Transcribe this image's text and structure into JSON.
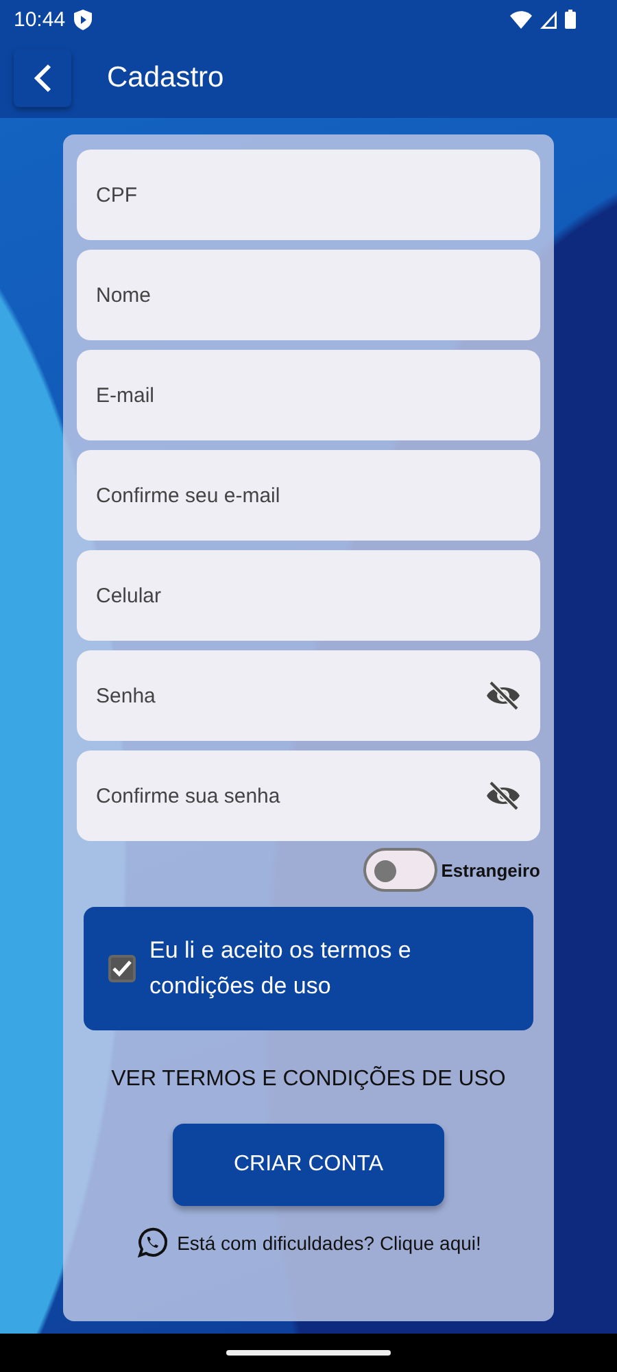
{
  "status_bar": {
    "time": "10:44"
  },
  "app_bar": {
    "title": "Cadastro"
  },
  "fields": [
    {
      "placeholder": "CPF",
      "kind": "text"
    },
    {
      "placeholder": "Nome",
      "kind": "text"
    },
    {
      "placeholder": "E-mail",
      "kind": "text"
    },
    {
      "placeholder": "Confirme seu e-mail",
      "kind": "text"
    },
    {
      "placeholder": "Celular",
      "kind": "text"
    },
    {
      "placeholder": "Senha",
      "kind": "password"
    },
    {
      "placeholder": "Confirme sua senha",
      "kind": "password"
    }
  ],
  "foreigner_switch": {
    "label": "Estrangeiro",
    "on": false
  },
  "terms_checkbox": {
    "label": "Eu li e aceito os termos e condições de uso",
    "checked": true
  },
  "terms_link": "VER TERMOS E CONDIÇÕES DE USO",
  "create_button": "CRIAR CONTA",
  "help_link": "Está com dificuldades? Clique aqui!"
}
